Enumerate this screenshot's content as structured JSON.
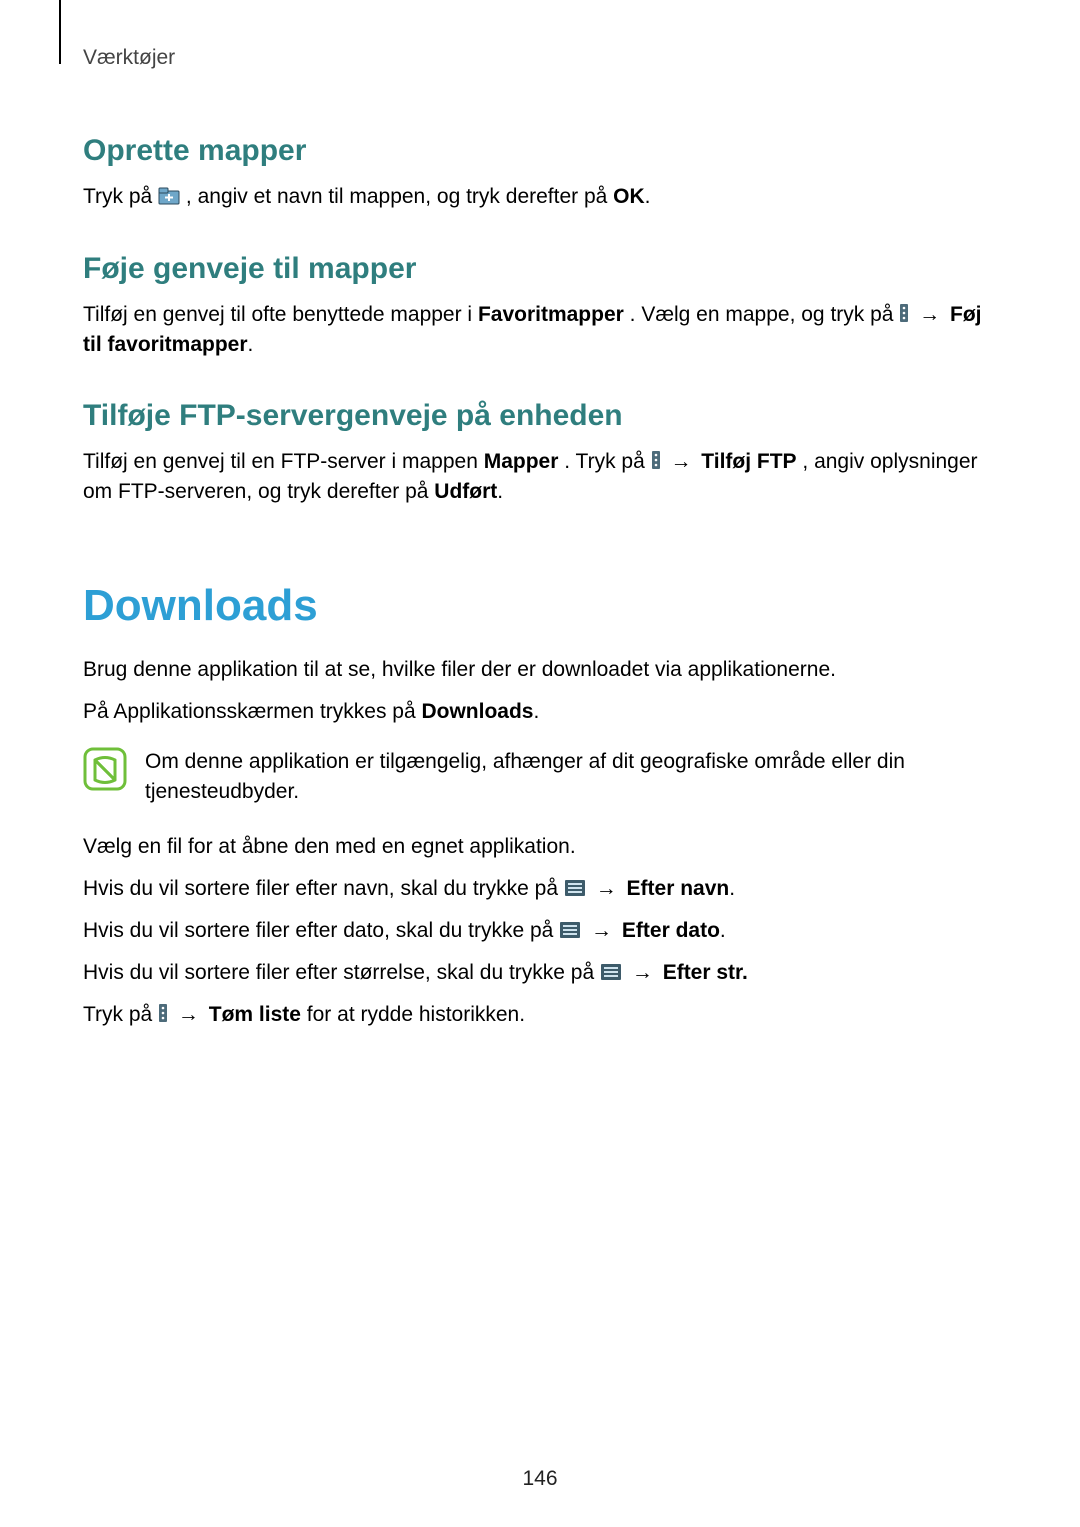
{
  "breadcrumb": "Værktøjer",
  "s1": {
    "h": "Oprette mapper",
    "p_a": "Tryk på ",
    "p_b": ", angiv et navn til mappen, og tryk derefter på ",
    "ok": "OK",
    "p_c": "."
  },
  "s2": {
    "h": "Føje genveje til mapper",
    "p_a": "Tilføj en genvej til ofte benyttede mapper i ",
    "fav": "Favoritmapper",
    "p_b": ". Vælg en mappe, og tryk på ",
    "arrow": "→",
    "add": "Føj til favoritmapper",
    "p_c": "."
  },
  "s3": {
    "h": "Tilføje FTP-servergenveje på enheden",
    "p_a": "Tilføj en genvej til en FTP-server i mappen ",
    "mapper": "Mapper",
    "p_b": ". Tryk på ",
    "arrow": "→",
    "tilfoj": "Tilføj FTP",
    "p_c": ", angiv oplysninger om FTP-serveren, og tryk derefter på ",
    "done": "Udført",
    "p_d": "."
  },
  "dl": {
    "h": "Downloads",
    "p1": "Brug denne applikation til at se, hvilke filer der er downloadet via applikationerne.",
    "p2_a": "På Applikationsskærmen trykkes på ",
    "p2_b": "Downloads",
    "p2_c": ".",
    "note": "Om denne applikation er tilgængelig, afhænger af dit geografiske område eller din tjenesteudbyder.",
    "p3": "Vælg en fil for at åbne den med en egnet applikation.",
    "sort_name_a": "Hvis du vil sortere filer efter navn, skal du trykke på ",
    "sort_name_b": "Efter navn",
    "sort_date_a": "Hvis du vil sortere filer efter dato, skal du trykke på ",
    "sort_date_b": "Efter dato",
    "sort_size_a": "Hvis du vil sortere filer efter størrelse, skal du trykke på ",
    "sort_size_b": "Efter str.",
    "clear_a": "Tryk på ",
    "clear_b": "Tøm liste",
    "clear_c": " for at rydde historikken.",
    "arrow": "→",
    "dot": "."
  },
  "page_number": "146"
}
